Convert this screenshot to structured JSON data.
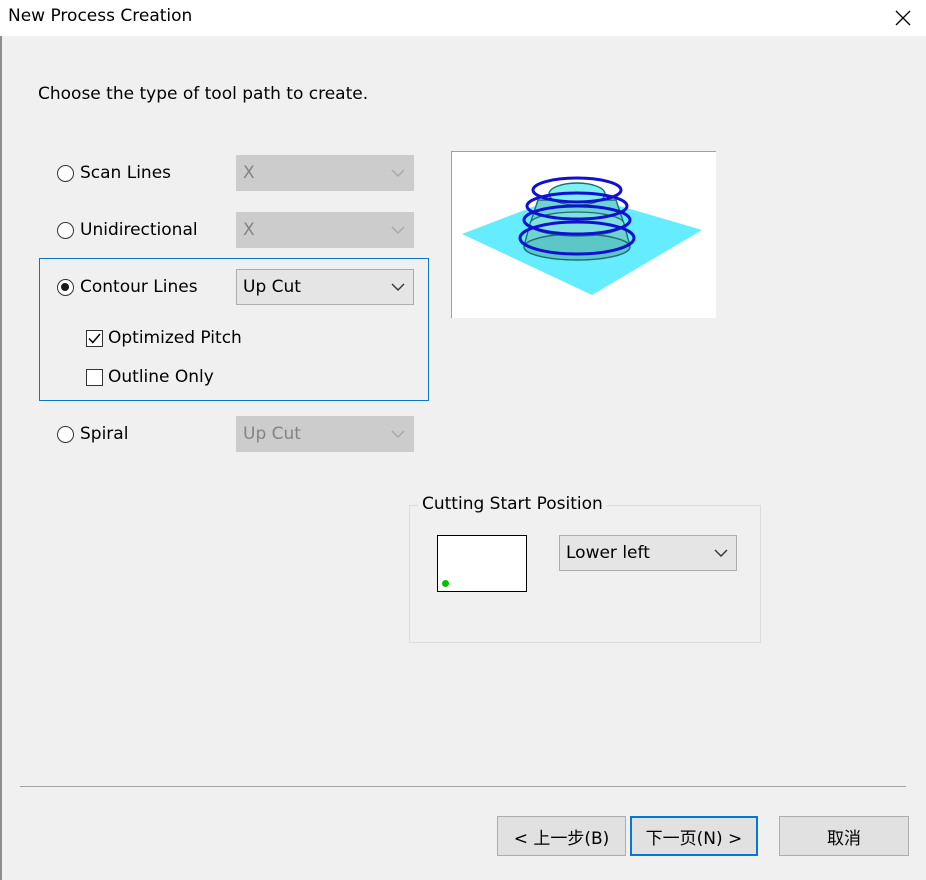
{
  "window": {
    "title": "New Process Creation"
  },
  "instruction": "Choose the type of tool path to create.",
  "options": {
    "scan_lines": {
      "label": "Scan Lines",
      "select_value": "X"
    },
    "unidirectional": {
      "label": "Unidirectional",
      "select_value": "X"
    },
    "contour_lines": {
      "label": "Contour Lines",
      "select_value": "Up Cut",
      "optimized_pitch": {
        "label": "Optimized Pitch",
        "checked": true
      },
      "outline_only": {
        "label": "Outline Only",
        "checked": false
      }
    },
    "spiral": {
      "label": "Spiral",
      "select_value": "Up Cut"
    },
    "selected": "contour_lines"
  },
  "cutting_start": {
    "legend": "Cutting Start Position",
    "select_value": "Lower left"
  },
  "buttons": {
    "back": "< 上一步(B)",
    "next": "下一页(N) >",
    "cancel": "取消"
  },
  "colors": {
    "accent": "#0078d7",
    "group_border": "#0a74c9",
    "preview_plane": "#66ecff",
    "preview_rings": "#1010d0",
    "start_dot": "#00c000"
  },
  "icons": [
    "close-icon",
    "chevron-down-icon",
    "checkmark-icon"
  ]
}
